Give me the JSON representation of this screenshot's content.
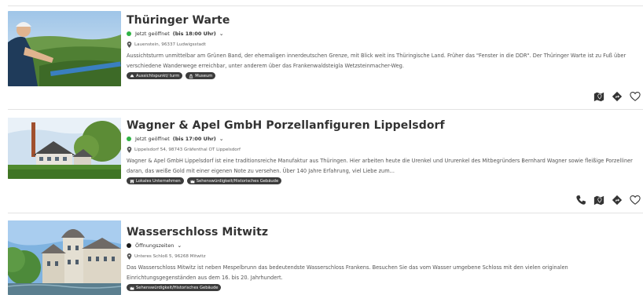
{
  "results": [
    {
      "title": "Thüringer Warte",
      "status": {
        "text": "Jetzt geöffnet",
        "hours": "(bis 18:00 Uhr)",
        "dot_color": "#2fb344"
      },
      "address": "Lauenstein, 96337 Ludwigsstadt",
      "description": "Aussichtsturm unmittelbar am Grünen Band, der ehemaligen innerdeutschen Grenze, mit Blick weit ins Thüringische Land. Früher das \"Fenster in die DDR\". Der Thüringer Warte ist zu Fuß über verschiedene Wanderwege erreichbar, unter anderem über das Frankenwaldsteigla Wetzsteinmacher-Weg.",
      "tags": [
        "Aussichtspunkt/ turm",
        "Museum"
      ],
      "actions": [
        "map-icon",
        "directions-icon",
        "favorite-icon"
      ]
    },
    {
      "title": "Wagner & Apel GmbH Porzellanfiguren Lippelsdorf",
      "status": {
        "text": "Jetzt geöffnet",
        "hours": "(bis 17:00 Uhr)",
        "dot_color": "#2fb344"
      },
      "address": "Lippelsdorf 54, 98743 Gräfenthal OT Lippelsdorf",
      "description": "Wagner & Apel GmbH Lippelsdorf ist eine traditionsreiche Manufaktur aus Thüringen. Hier arbeiten heute die Urenkel und Ururenkel des Mitbegründers Bernhard Wagner sowie fleißige Porzelliner daran, das weiße Gold mit einer eigenen Note zu versehen. Über 140 Jahre Erfahrung, viel Liebe zum...",
      "tags": [
        "Lokales Unternehmen",
        "Sehenswürdigkeit/Historisches Gebäude"
      ],
      "actions": [
        "phone-icon",
        "map-icon",
        "directions-icon",
        "favorite-icon"
      ]
    },
    {
      "title": "Wasserschloss Mitwitz",
      "status": {
        "text": "Öffnungszeiten",
        "hours": "",
        "dot_color": "#1a1a1a"
      },
      "address": "Unteres Schloß 5, 96268 Mitwitz",
      "description": "Das Wasserschloss Mitwitz ist neben Mespelbrunn das bedeutendste Wasserschloss Frankens. Besuchen Sie das vom Wasser umgebene Schloss mit den vielen originalen Einrichtungsgegenständen aus dem 16. bis 20. Jahrhundert.",
      "tags": [
        "Sehenswürdigkeit/Historisches Gebäude"
      ],
      "actions": []
    }
  ],
  "icons": {
    "chevron": "⌄"
  }
}
